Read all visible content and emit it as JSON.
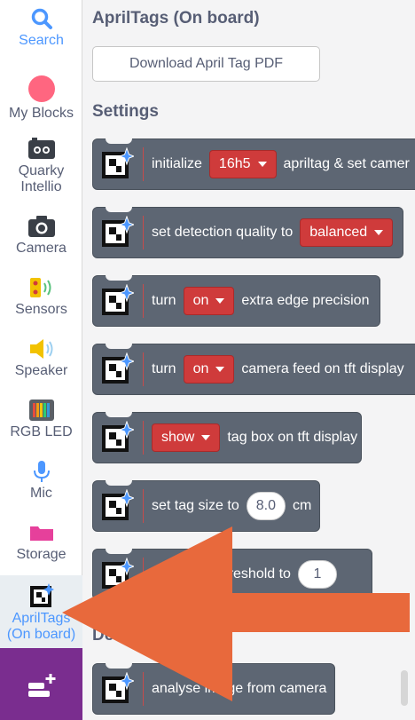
{
  "sidebar": {
    "items": [
      {
        "label": "Search",
        "icon": "search-icon"
      },
      {
        "label": "My Blocks",
        "icon": "my-blocks-icon"
      },
      {
        "label": "Quarky Intellio",
        "icon": "quarky-intellio-icon"
      },
      {
        "label": "Camera",
        "icon": "camera-icon"
      },
      {
        "label": "Sensors",
        "icon": "sensors-icon"
      },
      {
        "label": "Speaker",
        "icon": "speaker-icon"
      },
      {
        "label": "RGB LED",
        "icon": "rgb-led-icon"
      },
      {
        "label": "Mic",
        "icon": "mic-icon"
      },
      {
        "label": "Storage",
        "icon": "storage-icon"
      },
      {
        "label": "AprilTags (On board)",
        "icon": "apriltag-icon",
        "selected": true
      }
    ],
    "add_extension_icon": "add-extension-icon"
  },
  "main": {
    "title": "AprilTags (On board)",
    "download_label": "Download April Tag PDF",
    "settings_heading": "Settings",
    "detect_heading": "Dete",
    "blocks": {
      "init": {
        "text1": "initialize",
        "dropdown": "16h5",
        "text2": "apriltag & set camer"
      },
      "quality": {
        "text1": "set detection quality to",
        "dropdown": "balanced"
      },
      "edge": {
        "text1": "turn",
        "dropdown": "on",
        "text2": "extra edge precision"
      },
      "feed": {
        "text1": "turn",
        "dropdown": "on",
        "text2": "camera feed on tft display"
      },
      "box": {
        "dropdown": "show",
        "text2": "tag box on tft display"
      },
      "size": {
        "text1": "set tag size to",
        "value": "8.0",
        "text2": "cm"
      },
      "threshold": {
        "text1": "ce threshold to",
        "value": "1"
      },
      "analyse": {
        "text1": "analyse image from camera"
      }
    }
  },
  "colors": {
    "accent": "#4c97ff",
    "block": "#5d6673",
    "dropdown": "#cf3b3b",
    "arrow": "#e8693c",
    "extension": "#7a2d8f"
  }
}
